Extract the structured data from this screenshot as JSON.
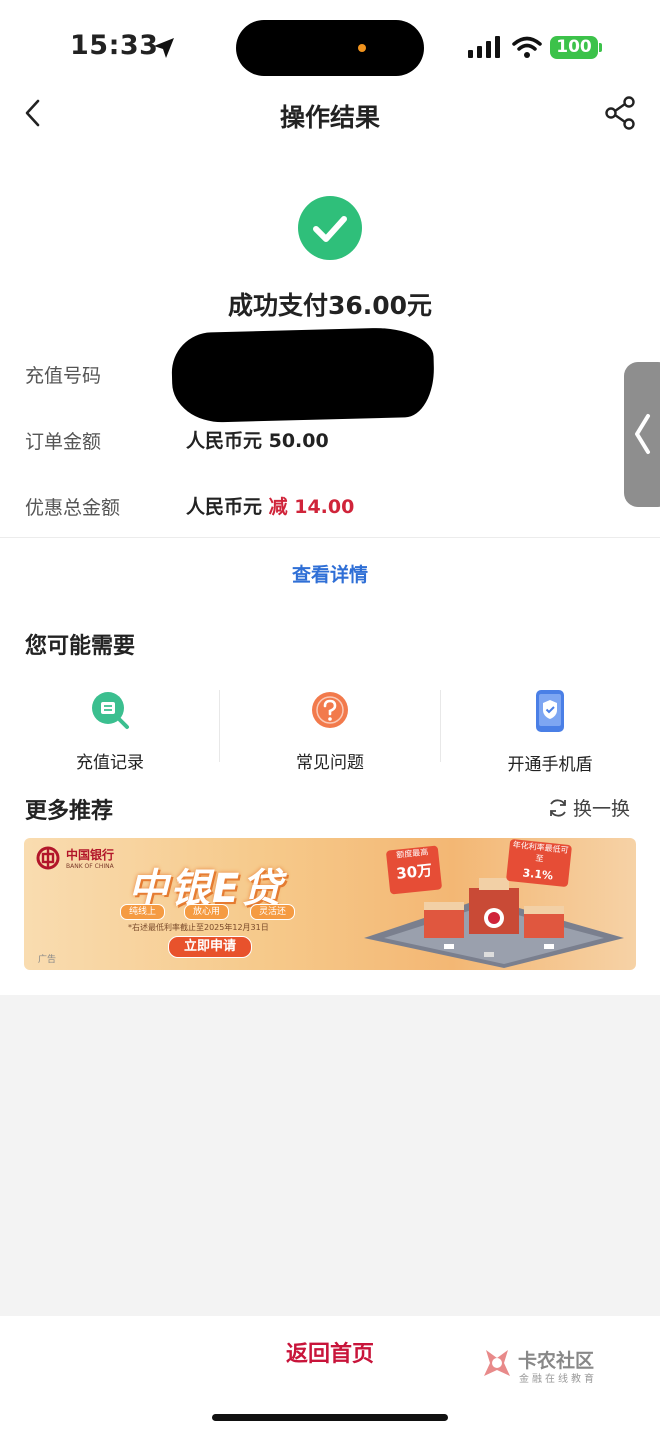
{
  "status_bar": {
    "time": "15:33",
    "battery": "100"
  },
  "nav": {
    "title": "操作结果"
  },
  "result": {
    "message": "成功支付36.00元"
  },
  "details": {
    "phone_label": "充值号码",
    "order_label": "订单金额",
    "order_value": "人民币元 50.00",
    "discount_label": "优惠总金额",
    "discount_prefix": "人民币元 ",
    "discount_value": "减 14.00"
  },
  "detail_link": "查看详情",
  "maybe_need": {
    "title": "您可能需要",
    "items": [
      {
        "label": "充值记录",
        "icon": "record-search-icon"
      },
      {
        "label": "常见问题",
        "icon": "question-icon"
      },
      {
        "label": "开通手机盾",
        "icon": "phone-shield-icon"
      }
    ]
  },
  "more": {
    "title": "更多推荐",
    "refresh_label": "换一换"
  },
  "banner": {
    "bank_name": "中国银行",
    "bank_name_en": "BANK OF CHINA",
    "title": "中银E贷",
    "pills": [
      "纯线上",
      "放心用",
      "灵活还"
    ],
    "note": "*右述最低利率截止至2025年12月31日",
    "apply": "立即申请",
    "ad_tag": "广告",
    "sign1_small": "额度最高",
    "sign1_big": "30万",
    "sign2_small": "年化利率最低可至",
    "sign2_big": "3.1%"
  },
  "bottom": {
    "home_label": "返回首页"
  },
  "watermark": {
    "name": "卡农社区",
    "sub": "金融在线教育"
  },
  "colors": {
    "success": "#2fbf7a",
    "link": "#2f6fd6",
    "discount": "#d0243a",
    "home": "#c8143a"
  }
}
